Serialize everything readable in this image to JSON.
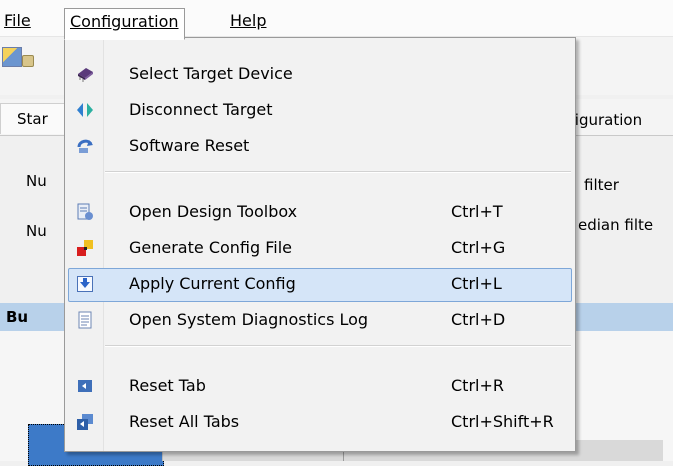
{
  "menubar": {
    "file": "File",
    "configuration": "Configuration",
    "help": "Help"
  },
  "tabs": {
    "left_partial": "Star",
    "right_partial": "nfiguration"
  },
  "background_text": {
    "nu1": "Nu",
    "nu2": "Nu",
    "filter": "filter",
    "median": "edian filte",
    "group": "Bu"
  },
  "menu": {
    "items": [
      {
        "label": "Select Target Device",
        "shortcut": "",
        "icon": "chip-icon"
      },
      {
        "label": "Disconnect Target",
        "shortcut": "",
        "icon": "disconnect-icon"
      },
      {
        "label": "Software Reset",
        "shortcut": "",
        "icon": "reset-arrow-icon"
      },
      {
        "label": "Open Design Toolbox",
        "shortcut": "Ctrl+T",
        "icon": "toolbox-icon"
      },
      {
        "label": "Generate Config File",
        "shortcut": "Ctrl+G",
        "icon": "generate-config-icon"
      },
      {
        "label": "Apply Current Config",
        "shortcut": "Ctrl+L",
        "icon": "apply-config-icon"
      },
      {
        "label": "Open System Diagnostics Log",
        "shortcut": "Ctrl+D",
        "icon": "log-document-icon"
      },
      {
        "label": "Reset Tab",
        "shortcut": "Ctrl+R",
        "icon": "reset-tab-icon"
      },
      {
        "label": "Reset All Tabs",
        "shortcut": "Ctrl+Shift+R",
        "icon": "reset-all-tabs-icon"
      }
    ],
    "selected": "Apply Current Config"
  },
  "colors": {
    "selection_bg": "#d5e5f8",
    "selection_border": "#7ea7d8",
    "group_header": "#b8d1ea"
  }
}
